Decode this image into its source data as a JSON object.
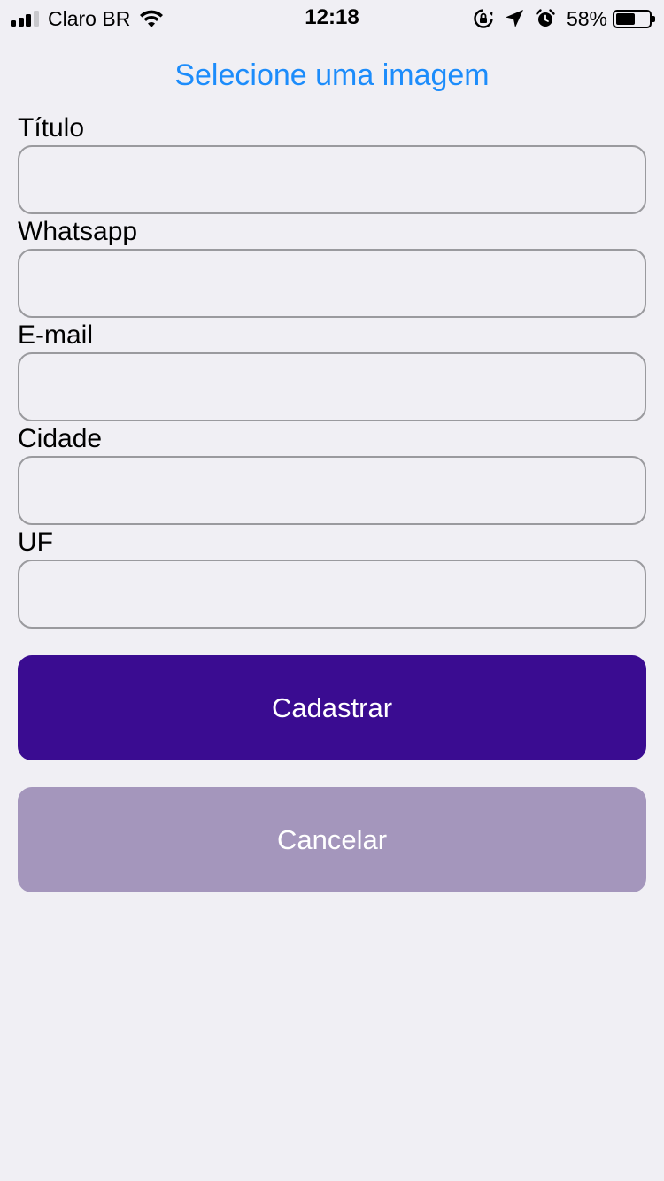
{
  "status_bar": {
    "carrier": "Claro BR",
    "time": "12:18",
    "battery_percent": "58%",
    "battery_level": 0.58,
    "signal_bars": 3,
    "icons": [
      "signal-icon",
      "wifi-icon",
      "rotation-lock-icon",
      "location-arrow-icon",
      "alarm-icon",
      "battery-icon"
    ]
  },
  "header": {
    "select_image_label": "Selecione uma imagem"
  },
  "form": {
    "fields": [
      {
        "label": "Título",
        "value": "",
        "placeholder": ""
      },
      {
        "label": "Whatsapp",
        "value": "",
        "placeholder": ""
      },
      {
        "label": "E-mail",
        "value": "",
        "placeholder": ""
      },
      {
        "label": "Cidade",
        "value": "",
        "placeholder": ""
      },
      {
        "label": "UF",
        "value": "",
        "placeholder": ""
      }
    ]
  },
  "actions": {
    "submit_label": "Cadastrar",
    "cancel_label": "Cancelar"
  },
  "colors": {
    "background": "#F0EFF4",
    "link": "#1C8CFB",
    "primary": "#3A0C91",
    "secondary": "#A496BC"
  }
}
